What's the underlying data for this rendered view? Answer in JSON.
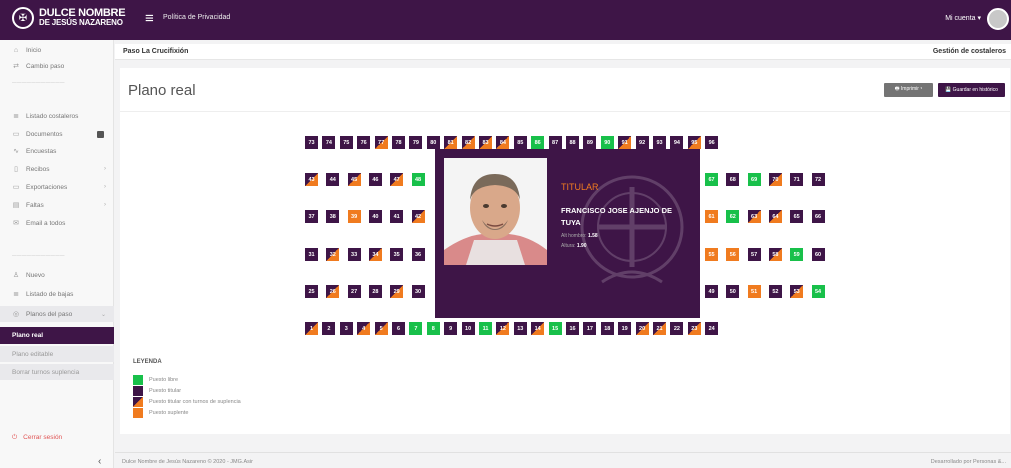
{
  "header": {
    "logo_line1": "DULCE NOMBRE",
    "logo_line2": "DE JESÚS NAZARENO",
    "privacy_link": "Política de Privacidad",
    "account_menu": "Mi cuenta ▾"
  },
  "sidebar": {
    "items": [
      {
        "label": "Inicio",
        "icon": "home-icon"
      },
      {
        "label": "Cambio paso",
        "icon": "swap-icon"
      },
      {
        "label": "Listado costaleros",
        "icon": "list-icon"
      },
      {
        "label": "Documentos",
        "icon": "folder-icon"
      },
      {
        "label": "Encuestas",
        "icon": "chart-icon"
      },
      {
        "label": "Recibos",
        "icon": "receipt-icon"
      },
      {
        "label": "Exportaciones",
        "icon": "export-icon"
      },
      {
        "label": "Faltas",
        "icon": "calendar-icon"
      },
      {
        "label": "Email a todos",
        "icon": "mail-icon"
      },
      {
        "label": "Nuevo",
        "icon": "user-plus-icon"
      },
      {
        "label": "Listado de bajas",
        "icon": "list-icon"
      },
      {
        "label": "Planos del paso",
        "icon": "map-icon"
      },
      {
        "label": "Plano real",
        "icon": ""
      },
      {
        "label": "Plano editable",
        "icon": ""
      },
      {
        "label": "Borrar turnos suplencia",
        "icon": ""
      }
    ],
    "logout": "Cerrar sesión"
  },
  "breadcrumb": {
    "left": "Paso La Crucifixión",
    "right": "Gestión de costaleros"
  },
  "panel": {
    "title": "Plano real",
    "print_label": "🖶 Imprimir ▾",
    "save_label": "💾 Guardar en histórico"
  },
  "seats": {
    "row1": [
      {
        "n": "73",
        "c": "p"
      },
      {
        "n": "74",
        "c": "p"
      },
      {
        "n": "75",
        "c": "p"
      },
      {
        "n": "76",
        "c": "p"
      },
      {
        "n": "77",
        "c": "s"
      },
      {
        "n": "78",
        "c": "p"
      },
      {
        "n": "79",
        "c": "p"
      },
      {
        "n": "80",
        "c": "p"
      },
      {
        "n": "81",
        "c": "s"
      },
      {
        "n": "82",
        "c": "s"
      },
      {
        "n": "83",
        "c": "s"
      },
      {
        "n": "84",
        "c": "s"
      },
      {
        "n": "85",
        "c": "p"
      },
      {
        "n": "86",
        "c": "g"
      },
      {
        "n": "87",
        "c": "p"
      },
      {
        "n": "88",
        "c": "p"
      },
      {
        "n": "89",
        "c": "p"
      },
      {
        "n": "90",
        "c": "g"
      },
      {
        "n": "91",
        "c": "s"
      },
      {
        "n": "92",
        "c": "p"
      },
      {
        "n": "93",
        "c": "p"
      },
      {
        "n": "94",
        "c": "p"
      },
      {
        "n": "95",
        "c": "s"
      },
      {
        "n": "96",
        "c": "p"
      }
    ],
    "row2_left": [
      {
        "n": "43",
        "c": "s"
      },
      {
        "n": "44",
        "c": "p"
      },
      {
        "n": "45",
        "c": "s"
      },
      {
        "n": "46",
        "c": "p"
      },
      {
        "n": "47",
        "c": "s"
      },
      {
        "n": "48",
        "c": "g"
      }
    ],
    "row2_right": [
      {
        "n": "67",
        "c": "g"
      },
      {
        "n": "68",
        "c": "p"
      },
      {
        "n": "69",
        "c": "g"
      },
      {
        "n": "70",
        "c": "s"
      },
      {
        "n": "71",
        "c": "p"
      },
      {
        "n": "72",
        "c": "p"
      }
    ],
    "row3_left": [
      {
        "n": "37",
        "c": "p"
      },
      {
        "n": "38",
        "c": "p"
      },
      {
        "n": "39",
        "c": "o"
      },
      {
        "n": "40",
        "c": "p"
      },
      {
        "n": "41",
        "c": "p"
      },
      {
        "n": "42",
        "c": "s"
      }
    ],
    "row3_right": [
      {
        "n": "61",
        "c": "o"
      },
      {
        "n": "62",
        "c": "g"
      },
      {
        "n": "63",
        "c": "s"
      },
      {
        "n": "64",
        "c": "s"
      },
      {
        "n": "65",
        "c": "p"
      },
      {
        "n": "66",
        "c": "p"
      }
    ],
    "row4_left": [
      {
        "n": "31",
        "c": "p"
      },
      {
        "n": "32",
        "c": "s"
      },
      {
        "n": "33",
        "c": "p"
      },
      {
        "n": "34",
        "c": "s"
      },
      {
        "n": "35",
        "c": "p"
      },
      {
        "n": "36",
        "c": "p"
      }
    ],
    "row4_right": [
      {
        "n": "55",
        "c": "o"
      },
      {
        "n": "56",
        "c": "o"
      },
      {
        "n": "57",
        "c": "p"
      },
      {
        "n": "58",
        "c": "s"
      },
      {
        "n": "59",
        "c": "g"
      },
      {
        "n": "60",
        "c": "p"
      }
    ],
    "row5_left": [
      {
        "n": "25",
        "c": "p"
      },
      {
        "n": "26",
        "c": "s"
      },
      {
        "n": "27",
        "c": "p"
      },
      {
        "n": "28",
        "c": "p"
      },
      {
        "n": "29",
        "c": "s"
      },
      {
        "n": "30",
        "c": "p"
      }
    ],
    "row5_right": [
      {
        "n": "49",
        "c": "p"
      },
      {
        "n": "50",
        "c": "p"
      },
      {
        "n": "51",
        "c": "o"
      },
      {
        "n": "52",
        "c": "p"
      },
      {
        "n": "53",
        "c": "s"
      },
      {
        "n": "54",
        "c": "g"
      }
    ],
    "row6": [
      {
        "n": "1",
        "c": "s"
      },
      {
        "n": "2",
        "c": "p"
      },
      {
        "n": "3",
        "c": "p"
      },
      {
        "n": "4",
        "c": "s"
      },
      {
        "n": "5",
        "c": "s"
      },
      {
        "n": "6",
        "c": "p"
      },
      {
        "n": "7",
        "c": "g"
      },
      {
        "n": "8",
        "c": "g"
      },
      {
        "n": "9",
        "c": "p"
      },
      {
        "n": "10",
        "c": "p"
      },
      {
        "n": "11",
        "c": "g"
      },
      {
        "n": "12",
        "c": "s"
      },
      {
        "n": "13",
        "c": "p"
      },
      {
        "n": "14",
        "c": "s"
      },
      {
        "n": "15",
        "c": "g"
      },
      {
        "n": "16",
        "c": "p"
      },
      {
        "n": "17",
        "c": "p"
      },
      {
        "n": "18",
        "c": "p"
      },
      {
        "n": "19",
        "c": "p"
      },
      {
        "n": "20",
        "c": "s"
      },
      {
        "n": "21",
        "c": "s"
      },
      {
        "n": "22",
        "c": "p"
      },
      {
        "n": "23",
        "c": "s"
      },
      {
        "n": "24",
        "c": "p"
      }
    ]
  },
  "card": {
    "role": "TITULAR",
    "name": "FRANCISCO JOSE AJENJO DE TUYA",
    "alt1_label": "Alt hombro:",
    "alt1_value": "1.58",
    "alt2_label": "Altura:",
    "alt2_value": "1.90"
  },
  "legend": {
    "title": "LEYENDA",
    "items": [
      {
        "label": "Puesto libre",
        "type": "green"
      },
      {
        "label": "Puesto titular",
        "type": "purple"
      },
      {
        "label": "Puesto titular con turnos de suplencia",
        "type": "split"
      },
      {
        "label": "Puesto suplente",
        "type": "orange"
      }
    ]
  },
  "footer": {
    "left": "Dulce Nombre de Jesús Nazareno © 2020 - JMG.Asir",
    "right": "Desarrollado por Personas &..."
  },
  "colors": {
    "brand": "#3e1547",
    "free": "#18c04a",
    "substitute": "#f07b1f"
  }
}
